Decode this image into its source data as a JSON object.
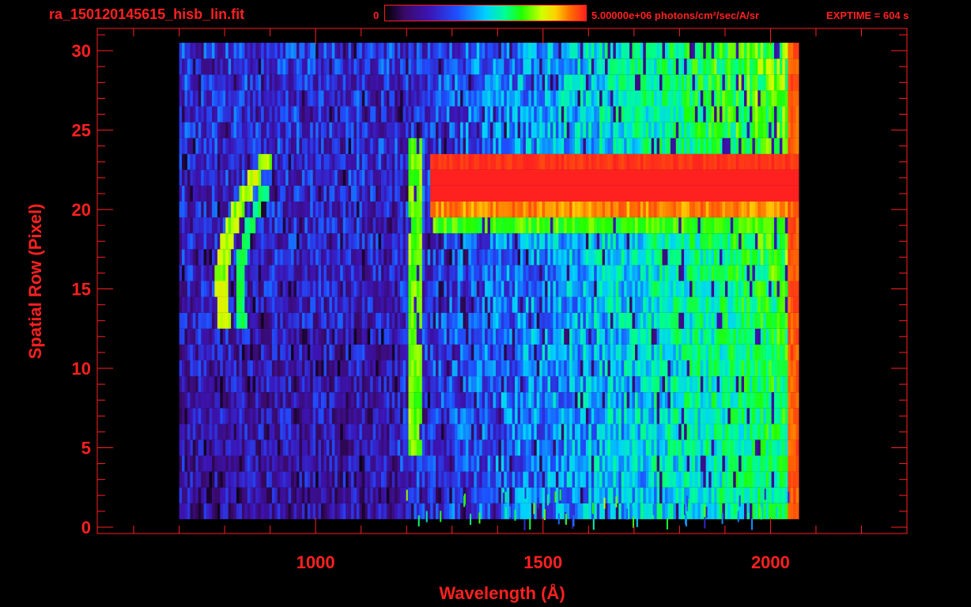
{
  "header": {
    "filename": "ra_150120145615_hisb_lin.fit",
    "colorbar_min_label": "0",
    "colorbar_max_label": "5.00000e+06 photons/cm²/sec/A/sr",
    "exptime": "EXPTIME = 604 s"
  },
  "colors": {
    "text": "#ff2020",
    "background": "#000000",
    "colormap": [
      "#000000",
      "#3a0a6a",
      "#3c14b4",
      "#1e50ff",
      "#00d0ff",
      "#00ff90",
      "#20ff00",
      "#d0ff00",
      "#ffd000",
      "#ff7000",
      "#ff2020"
    ]
  },
  "chart_data": {
    "type": "heatmap",
    "xlabel": "Wavelength (Å)",
    "ylabel": "Spatial Row (Pixel)",
    "xlim": [
      520,
      2300
    ],
    "ylim": [
      -0.4,
      31.4
    ],
    "x_ticks": [
      1000,
      1500,
      2000
    ],
    "y_ticks": [
      0,
      5,
      10,
      15,
      20,
      25,
      30
    ],
    "colorbar_range": [
      0,
      5000000
    ],
    "data_extent_wavelength": [
      700,
      2060
    ],
    "rows": 30,
    "grid": false,
    "features": [
      {
        "name": "vertical emission line",
        "wavelength": 1216,
        "rows": [
          5,
          24
        ],
        "level": 0.65
      },
      {
        "name": "saturated band",
        "wavelength": [
          1250,
          2060
        ],
        "rows": [
          20,
          23
        ],
        "level": 1.0
      },
      {
        "name": "curved arc",
        "wavelength": [
          780,
          950
        ],
        "rows": [
          13,
          23
        ],
        "level": 0.6
      },
      {
        "name": "red edge",
        "wavelength": 2045,
        "rows": [
          3,
          30
        ],
        "level": 0.9
      }
    ]
  }
}
